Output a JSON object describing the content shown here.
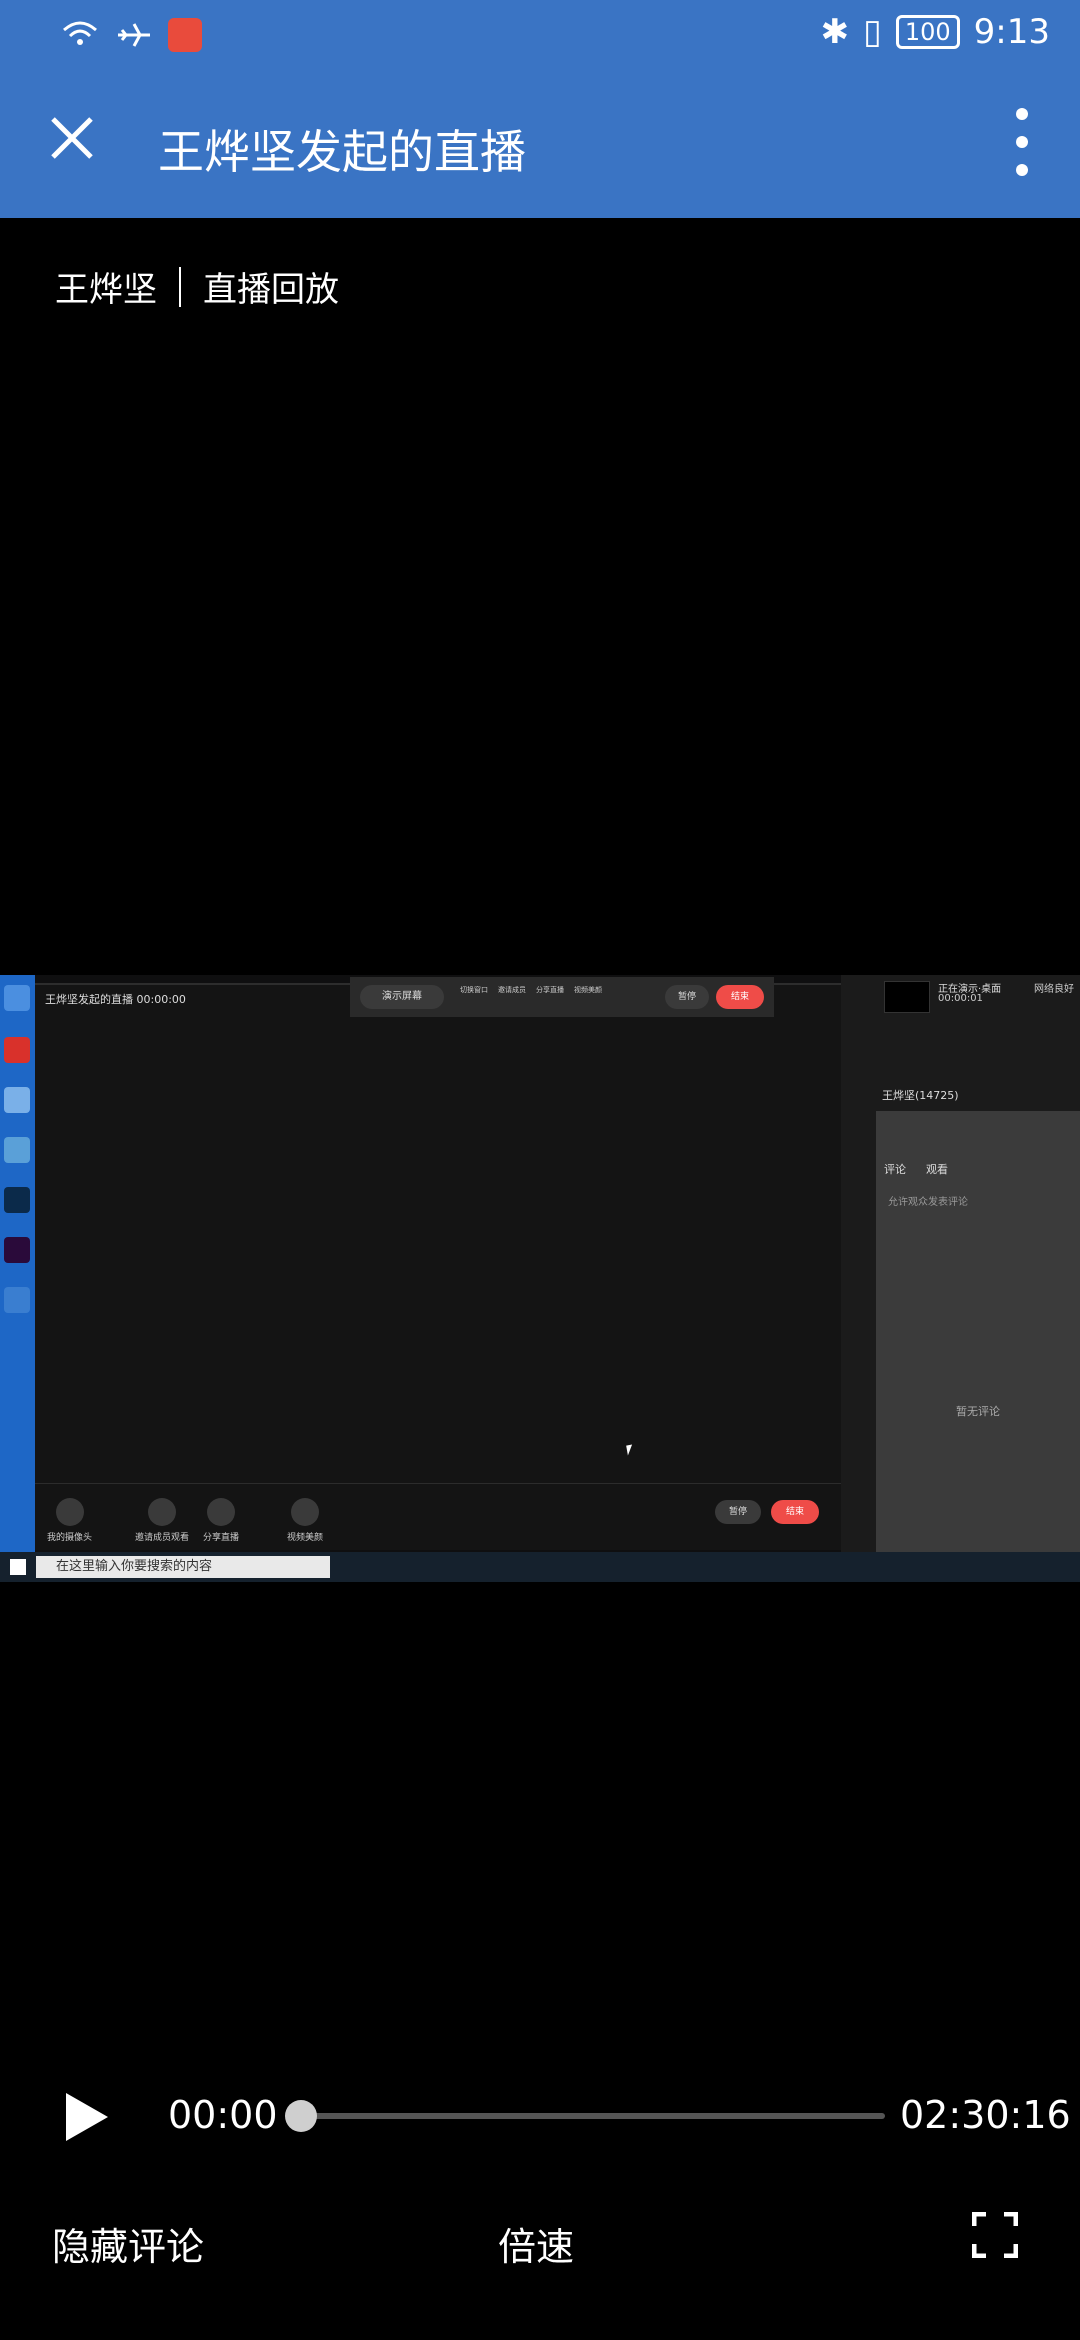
{
  "status_bar": {
    "battery": "100",
    "time": "9:13"
  },
  "app_bar": {
    "title": "王烨坚发起的直播"
  },
  "subtitle": {
    "host": "王烨坚",
    "tag": "直播回放"
  },
  "video": {
    "inner_title": "王烨坚发起的直播 00:00:00",
    "toolbar_present_screen": "演示屏幕",
    "toolbar_switch": "切换窗口",
    "toolbar_invite": "邀请成员",
    "toolbar_share": "分享直播",
    "toolbar_beauty": "视频美颜",
    "toolbar_pause": "暂停",
    "toolbar_end": "结束",
    "bottom_camera": "我的摄像头",
    "bottom_invite": "邀请成员观看",
    "bottom_share": "分享直播",
    "bottom_beauty": "视频美颜",
    "bottom_pause": "暂停",
    "bottom_end": "结束",
    "panel_status": "正在演示·桌面",
    "panel_time": "00:00:01",
    "panel_net": "网络良好",
    "panel_host": "王烨坚(14725)",
    "panel_tab_comments": "评论",
    "panel_tab_viewers": "观看",
    "panel_allow": "允许观众发表评论",
    "panel_empty": "暂无评论",
    "taskbar_search": "在这里输入你要搜索的内容"
  },
  "player": {
    "current_time": "00:00",
    "total_time": "02:30:16",
    "progress": 0.0
  },
  "footer": {
    "hide_comments": "隐藏评论",
    "speed": "倍速"
  }
}
